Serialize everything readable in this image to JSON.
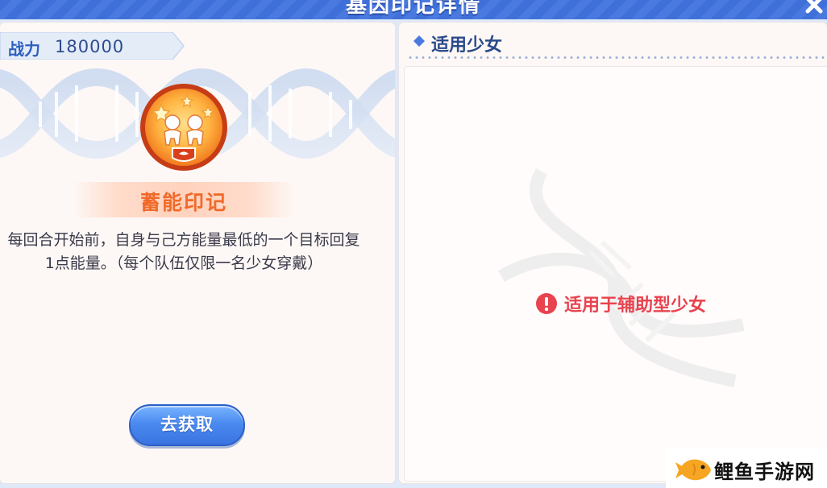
{
  "header": {
    "title": "基因印记详情"
  },
  "left_panel": {
    "power_label": "战力",
    "power_value": "180000",
    "mark_name": "蓄能印记",
    "description": "每回合开始前，自身与己方能量最低的一个目标回复1点能量。（每个队伍仅限一名少女穿戴）",
    "get_button_label": "去获取",
    "badge_icon": "two-figures-badge-icon"
  },
  "right_panel": {
    "section_title": "适用少女",
    "notice_text": "适用于辅助型少女",
    "notice_icon": "alert-circle-icon"
  },
  "watermark": {
    "text": "鲤鱼手游网",
    "icon": "fish-icon"
  },
  "colors": {
    "title_bar": "#3f6fd8",
    "panel_bg": "#fdf8f6",
    "accent_orange": "#f06a2a",
    "accent_blue": "#2a4a8a",
    "alert_red": "#e8434f",
    "button_blue": "#4a8af0"
  }
}
